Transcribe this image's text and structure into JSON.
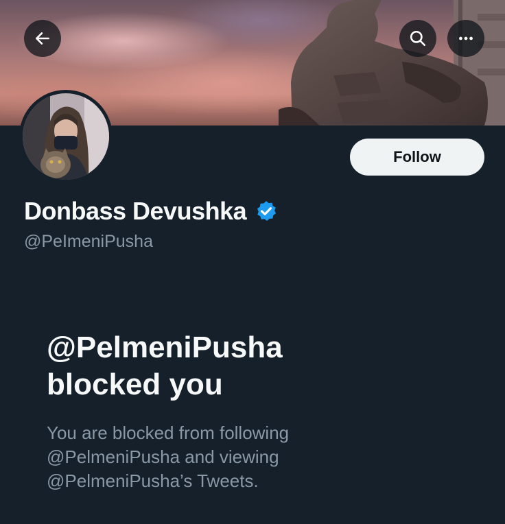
{
  "header": {
    "back_icon": "arrow-left-icon",
    "search_icon": "search-icon",
    "more_icon": "more-horizontal-icon"
  },
  "profile": {
    "display_name": "Donbass Devushka",
    "handle": "@PeImeniPusha",
    "verified_icon": "verified-badge-icon",
    "follow_label": "Follow"
  },
  "blocked": {
    "title_line1": "@PelmeniPusha",
    "title_line2": "blocked you",
    "description_line1": "You are blocked from following",
    "description_line2": "@PelmeniPusha and viewing",
    "description_line3": "@PelmeniPusha’s Tweets."
  },
  "colors": {
    "background": "#15202b",
    "verified_blue": "#1d9bf0",
    "secondary_text": "#8b98a5",
    "follow_button_bg": "#eff3f4"
  }
}
